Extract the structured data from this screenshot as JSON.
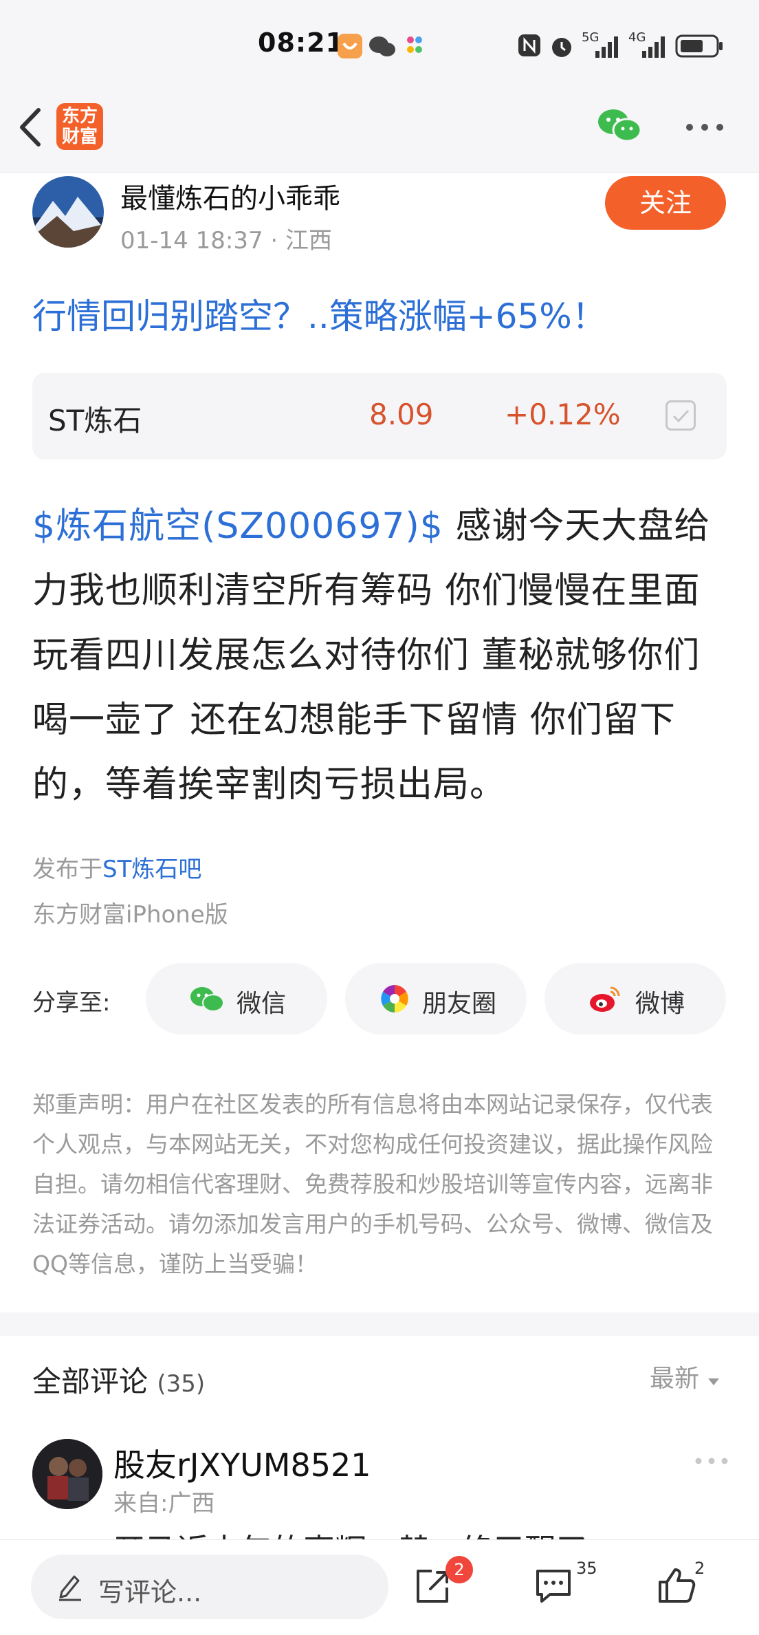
{
  "status_bar": {
    "time": "08:21",
    "network_1": "5G",
    "network_2": "4G"
  },
  "nav": {
    "logo_line1": "东方",
    "logo_line2": "财富"
  },
  "post": {
    "author_name": "最懂炼石的小乖乖",
    "meta": "01-14 18:37 · 江西",
    "follow_label": "关注",
    "headline": "行情回归别踏空？..策略涨幅+65%！",
    "stock": {
      "name": "ST炼石",
      "price": "8.09",
      "change": "+0.12%"
    },
    "body_tag": "$炼石航空(SZ000697)$",
    "body_text": " 感谢今天大盘给力我也顺利清空所有筹码 你们慢慢在里面玩看四川发展怎么对待你们 董秘就够你们喝一壶了 还在幻想能手下留情 你们留下的，等着挨宰割肉亏损出局。",
    "published_prefix": "发布于",
    "published_bar": "ST炼石吧",
    "client": "东方财富iPhone版"
  },
  "share": {
    "label": "分享至:",
    "wechat": "微信",
    "moments": "朋友圈",
    "weibo": "微博"
  },
  "disclaimer": "郑重声明：用户在社区发表的所有信息将由本网站记录保存，仅代表个人观点，与本网站无关，不对您构成任何投资建议，据此操作风险自担。请勿相信代客理财、免费荐股和炒股培训等宣传内容，远离非法证券活动。请勿添加发言用户的手机号码、公众号、微博、微信及QQ等信息，谨防上当受骗！",
  "comments": {
    "title": "全部评论",
    "count": "(35)",
    "sort": "最新",
    "first": {
      "name": "股友rJXYUM8521",
      "location": "来自:广西",
      "peek": "开马近十年的声辉　替　终于醒了"
    }
  },
  "bottom_bar": {
    "placeholder": "写评论...",
    "share_badge": "2",
    "comment_count": "35",
    "like_count": "2"
  },
  "colors": {
    "accent": "#f4602a",
    "link": "#2c6fd6",
    "price": "#d6532d"
  }
}
